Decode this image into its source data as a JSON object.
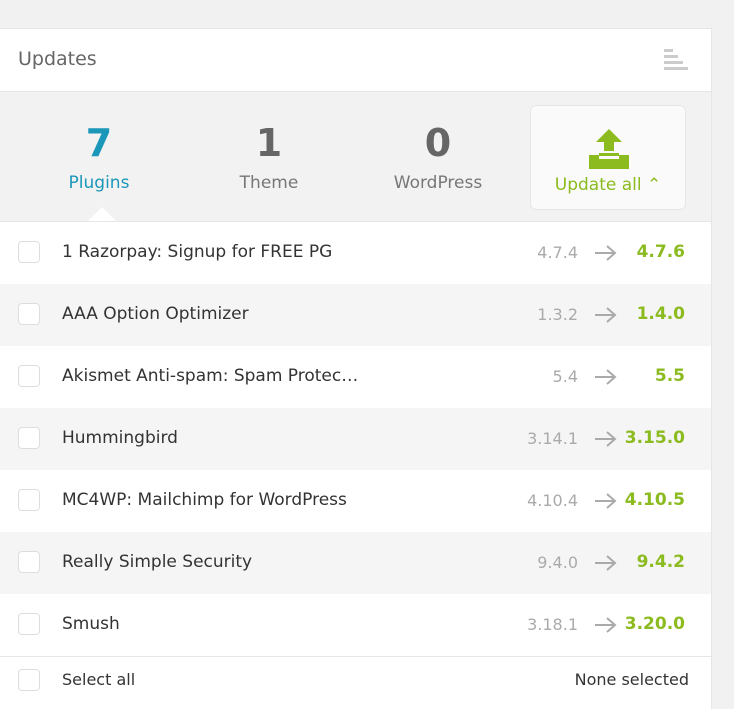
{
  "header": {
    "title": "Updates"
  },
  "stats": [
    {
      "count": "7",
      "label": "Plugins"
    },
    {
      "count": "1",
      "label": "Theme"
    },
    {
      "count": "0",
      "label": "WordPress"
    }
  ],
  "update_all": {
    "label": "Update all ⌃"
  },
  "plugins": [
    {
      "name": "1 Razorpay: Signup for FREE PG",
      "old": "4.7.4",
      "new": "4.7.6"
    },
    {
      "name": "AAA Option Optimizer",
      "old": "1.3.2",
      "new": "1.4.0"
    },
    {
      "name": "Akismet Anti-spam: Spam Protec…",
      "old": "5.4",
      "new": "5.5"
    },
    {
      "name": "Hummingbird",
      "old": "3.14.1",
      "new": "3.15.0"
    },
    {
      "name": "MC4WP: Mailchimp for WordPress",
      "old": "4.10.4",
      "new": "4.10.5"
    },
    {
      "name": "Really Simple Security",
      "old": "9.4.0",
      "new": "9.4.2"
    },
    {
      "name": "Smush",
      "old": "3.18.1",
      "new": "3.20.0"
    }
  ],
  "footer": {
    "select_all": "Select all",
    "none_selected": "None selected"
  },
  "colors": {
    "accent_blue": "#1a97b9",
    "accent_green": "#8bbb1f"
  }
}
